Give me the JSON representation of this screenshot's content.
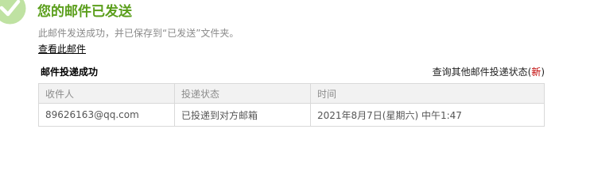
{
  "header": {
    "title": "您的邮件已发送",
    "subtitle": "此邮件发送成功，并已保存到“已发送”文件夹。",
    "view_link": "查看此邮件",
    "success_color": "#5a9e1b",
    "icon": "check-circle-icon"
  },
  "delivery": {
    "section_title": "邮件投递成功",
    "query_link": "查询其他邮件投递状态",
    "query_link_paren_open": "(",
    "new_tag": "新",
    "query_link_paren_close": ")",
    "columns": [
      "收件人",
      "投递状态",
      "时间"
    ],
    "rows": [
      {
        "recipient": "89626163@qq.com",
        "status": "已投递到对方邮箱",
        "time": "2021年8月7日(星期六) 中午1:47"
      }
    ]
  }
}
